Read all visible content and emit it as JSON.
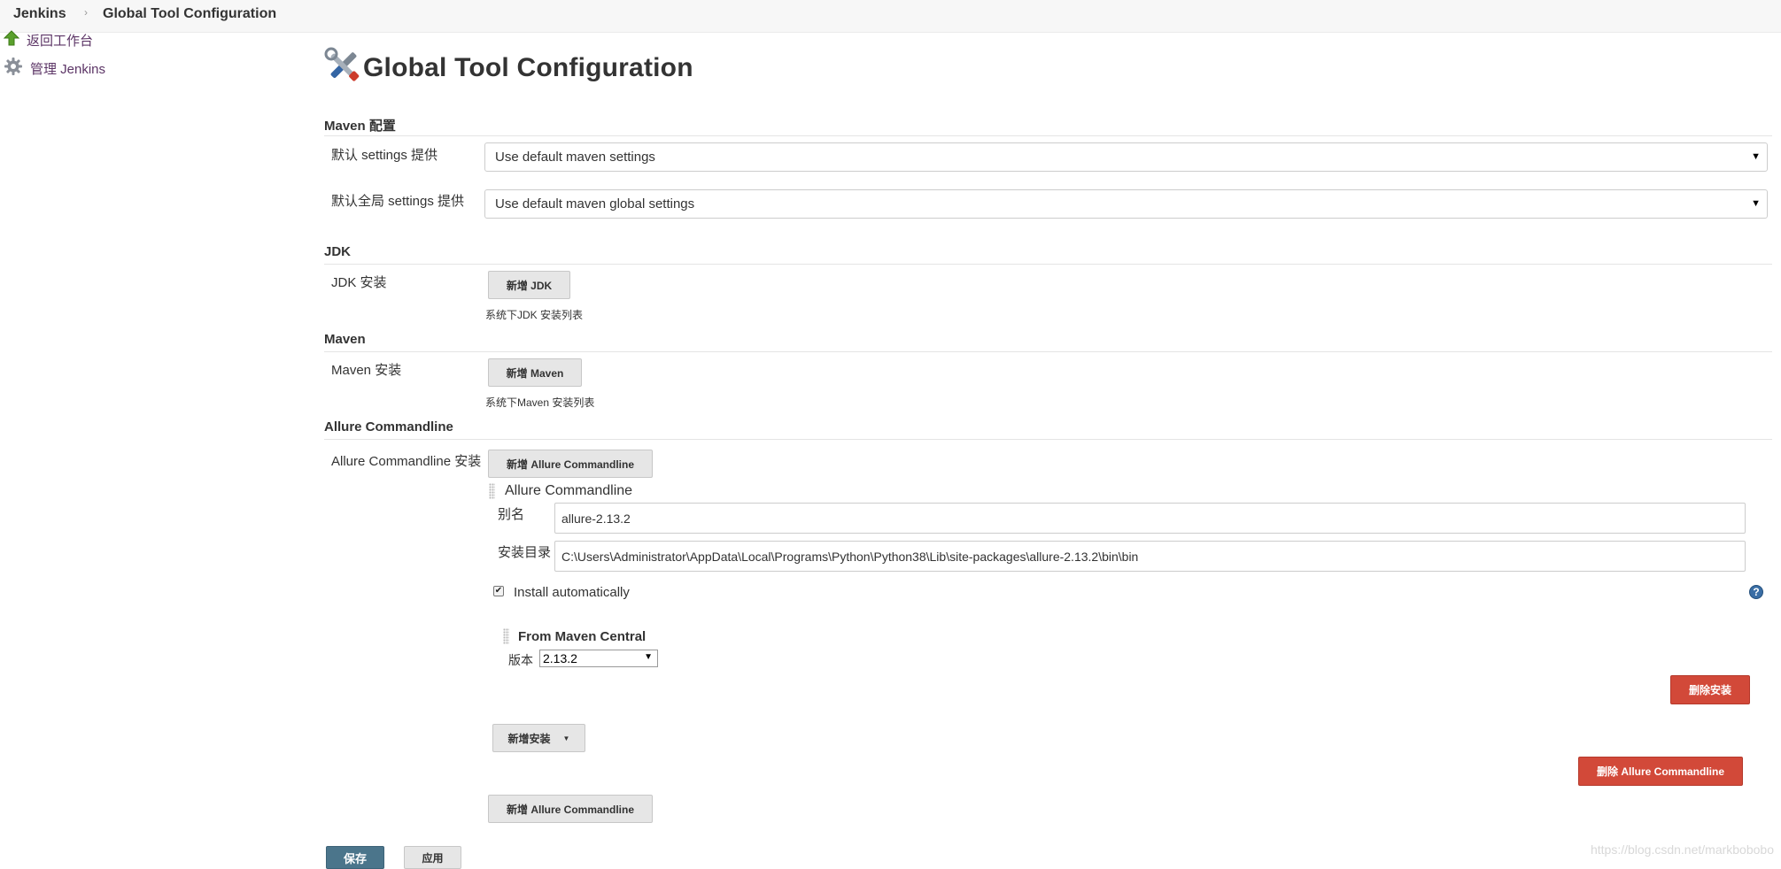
{
  "breadcrumb": {
    "home": "Jenkins",
    "separator": "›",
    "current": "Global Tool Configuration"
  },
  "sidebar": {
    "items": [
      {
        "label": "返回工作台",
        "icon": "up-arrow-icon"
      },
      {
        "label": "管理 Jenkins",
        "icon": "gear-icon"
      }
    ]
  },
  "page": {
    "title": "Global Tool Configuration",
    "icon": "tools-icon"
  },
  "maven_config": {
    "header": "Maven 配置",
    "settings_label": "默认 settings 提供",
    "settings_value": "Use default maven settings",
    "global_settings_label": "默认全局 settings 提供",
    "global_settings_value": "Use default maven global settings"
  },
  "jdk": {
    "header": "JDK",
    "install_label": "JDK 安装",
    "add_button": "新增 JDK",
    "description": "系统下JDK 安装列表"
  },
  "maven": {
    "header": "Maven",
    "install_label": "Maven 安装",
    "add_button": "新增 Maven",
    "description": "系统下Maven 安装列表"
  },
  "allure": {
    "header": "Allure Commandline",
    "install_label": "Allure Commandline 安装",
    "add_button": "新增 Allure Commandline",
    "item_title": "Allure Commandline",
    "alias_label": "别名",
    "alias_value": "allure-2.13.2",
    "home_label": "安装目录",
    "home_value": "C:\\Users\\Administrator\\AppData\\Local\\Programs\\Python\\Python38\\Lib\\site-packages\\allure-2.13.2\\bin\\bin",
    "install_auto_label": "Install automatically",
    "install_auto_checked": true,
    "installer_title": "From Maven Central",
    "version_label": "版本",
    "version_value": "2.13.2",
    "delete_installer_button": "删除安装",
    "add_installer_button": "新增安装",
    "delete_tool_button": "删除 Allure Commandline",
    "add_button_bottom": "新增 Allure Commandline"
  },
  "footer": {
    "save_button": "保存",
    "apply_button": "应用"
  },
  "watermark": "https://blog.csdn.net/markbobobo",
  "colors": {
    "delete_red": "#d24939",
    "save_blue": "#4b758b",
    "link_purple": "#5c3566",
    "help_blue": "#3a6ea5"
  }
}
